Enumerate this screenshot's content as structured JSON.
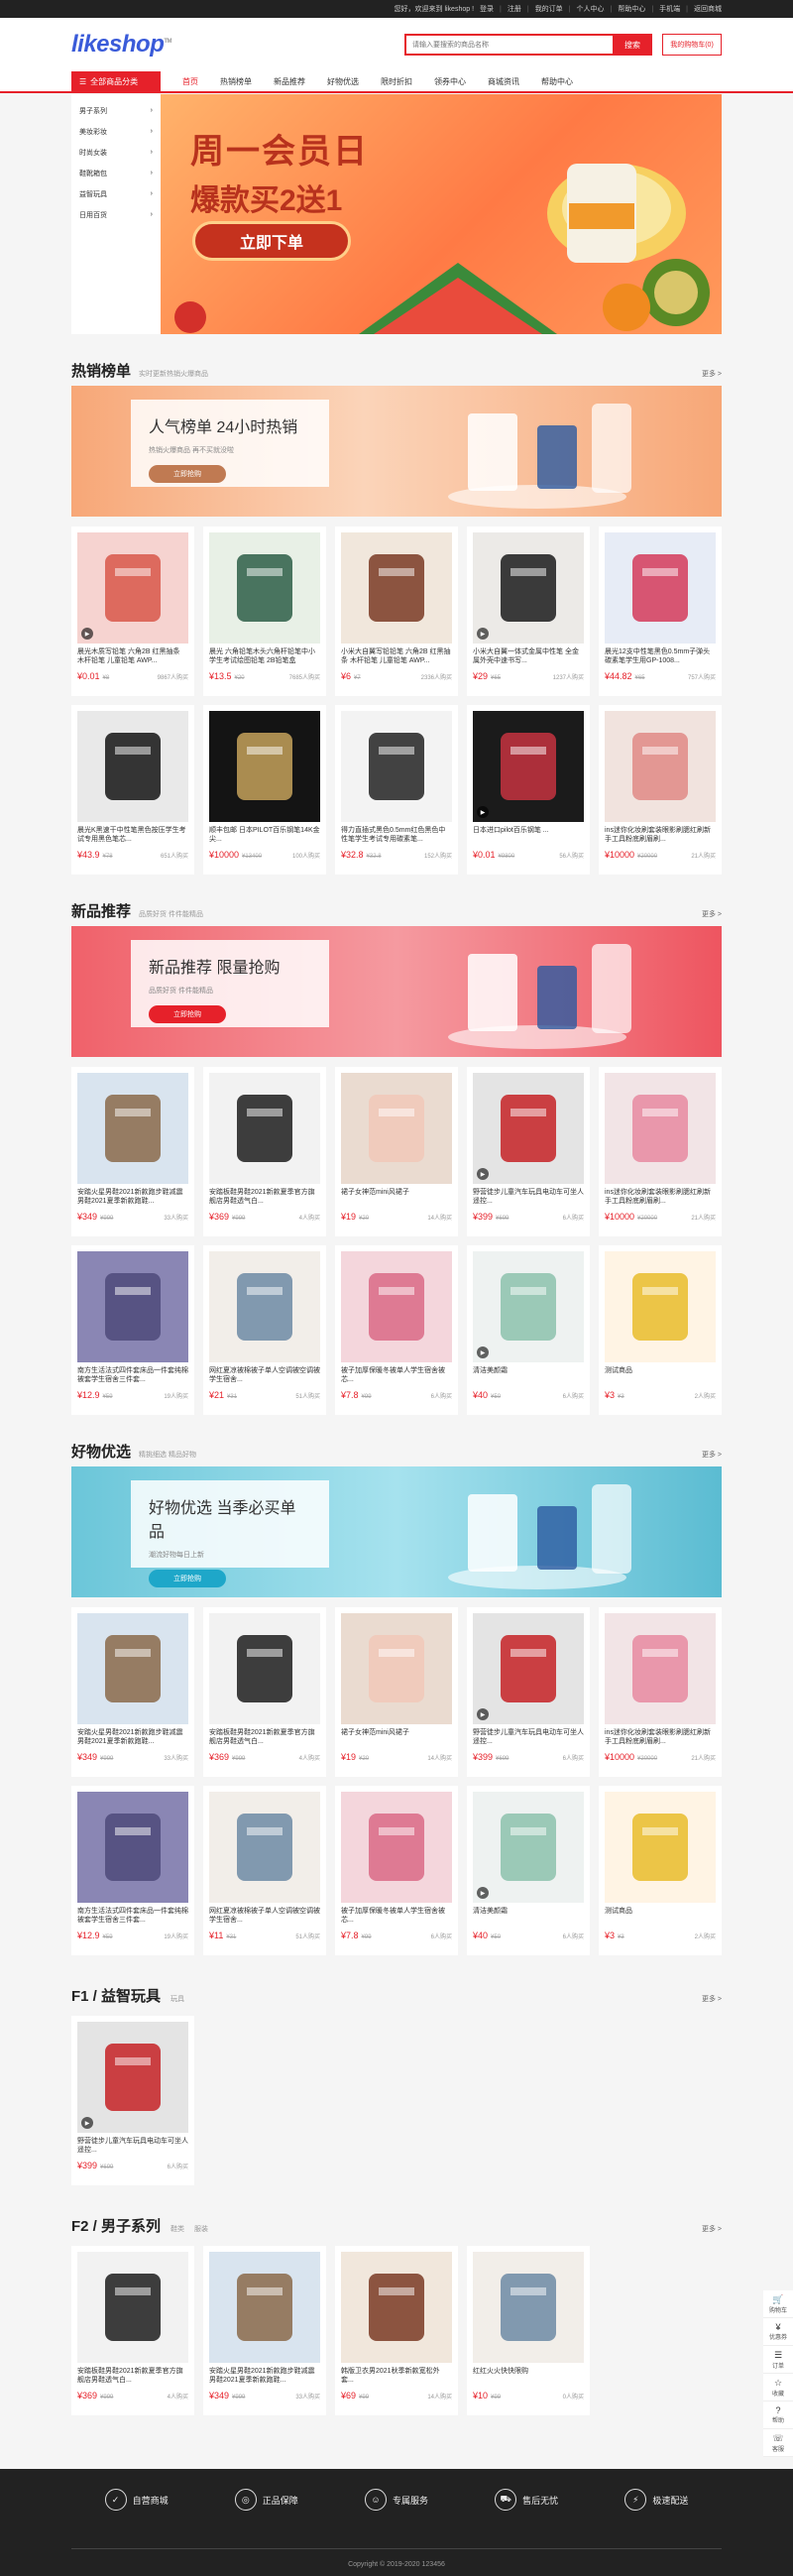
{
  "topbar": {
    "welcome": "您好，欢迎来到 likeshop !",
    "login": "登录",
    "register": "注册",
    "orders": "我的订单",
    "personal": "个人中心",
    "help": "帮助中心",
    "mobile": "手机端",
    "store": "返回商城"
  },
  "header": {
    "logo": "likeshop",
    "logo_tm": "TM",
    "search_placeholder": "请输入要搜索的商品名称",
    "search_btn": "搜索",
    "cart": "我的购物车(0)"
  },
  "nav": {
    "category": "全部商品分类",
    "items": [
      "首页",
      "热销榜单",
      "新品推荐",
      "好物优选",
      "限时折扣",
      "领券中心",
      "商城资讯",
      "帮助中心"
    ]
  },
  "catmenu": [
    "男子系列",
    "美妆彩妆",
    "时尚女装",
    "鞋靴箱包",
    "益智玩具",
    "日用百货"
  ],
  "hero": {
    "title": "周一会员日",
    "subtitle": "爆款买2送1",
    "button": "立即下单"
  },
  "hot": {
    "title": "热销榜单",
    "sub": "实时更新热销火爆商品",
    "more": "更多 >",
    "banner_title": "人气榜单 24小时热销",
    "banner_sub": "热销火爆商品 再不买就没啦",
    "banner_btn": "立即抢购",
    "items": [
      {
        "name": "晨光木质写铅笔 六角2B 红黑抽条 木杆铅笔 儿童铅笔 AWP...",
        "price": "¥0.01",
        "orig": "¥8",
        "sold": "9867人购买"
      },
      {
        "name": "晨光 六角铅笔木头六角杆铅笔中小学生考试绘图铅笔 2B铅笔盒",
        "price": "¥13.5",
        "orig": "¥20",
        "sold": "7685人购买"
      },
      {
        "name": "小米大自翼写铅铅笔 六角2B 红黑抽条 木杆铅笔 儿童铅笔 AWP...",
        "price": "¥6",
        "orig": "¥7",
        "sold": "2336人购买"
      },
      {
        "name": "小米大自翼一体式金属中性笔 全金属外壳中速书写...",
        "price": "¥29",
        "orig": "¥65",
        "sold": "1237人购买"
      },
      {
        "name": "晨光12支中性笔黑色0.5mm子弹头碳素笔学生用GP-1008...",
        "price": "¥44.82",
        "orig": "¥65",
        "sold": "757人购买"
      },
      {
        "name": "晨光K黑速干中性笔黑色按压学生考试专用黑色笔芯...",
        "price": "¥43.9",
        "orig": "¥78",
        "sold": "651人购买"
      },
      {
        "name": "顺丰包邮 日本PILOT百乐钢笔14K金尖...",
        "price": "¥10000",
        "orig": "¥13400",
        "sold": "100人购买"
      },
      {
        "name": "得力直插式黑色0.5mm红色黑色中性笔学生考试专用碳素笔...",
        "price": "¥32.8",
        "orig": "¥32.8",
        "sold": "152人购买"
      },
      {
        "name": "日本进口pilot百乐钢笔 ...",
        "price": "¥0.01",
        "orig": "¥9800",
        "sold": "56人购买"
      },
      {
        "name": "ins迷你化妆刷套装眼影刷腮红刷新手工具粉底刷眉刷...",
        "price": "¥10000",
        "orig": "¥20000",
        "sold": "21人购买"
      }
    ]
  },
  "new": {
    "title": "新品推荐",
    "sub": "品质好货 件件能精品",
    "more": "更多 >",
    "banner_title": "新品推荐 限量抢购",
    "banner_sub": "品质好货 件件能精品",
    "banner_btn": "立即抢购",
    "items": [
      {
        "name": "安踏火星男鞋2021新款跑步鞋减震男鞋2021夏季新款跑鞋...",
        "price": "¥349",
        "orig": "¥999",
        "sold": "33人购买"
      },
      {
        "name": "安踏板鞋男鞋2021新款夏季官方旗舰店男鞋透气白...",
        "price": "¥369",
        "orig": "¥999",
        "sold": "4人购买"
      },
      {
        "name": "裙子女神范mini风裙子",
        "price": "¥19",
        "orig": "¥20",
        "sold": "14人购买"
      },
      {
        "name": "野营徒步儿童汽车玩具电动车可坐人遥控...",
        "price": "¥399",
        "orig": "¥699",
        "sold": "6人购买"
      },
      {
        "name": "ins迷你化妆刷套装眼影刷腮红刷新手工具粉底刷眉刷...",
        "price": "¥10000",
        "orig": "¥20000",
        "sold": "21人购买"
      },
      {
        "name": "南方生活法式四件套床品一件套纯棉被套学生宿舍三件套...",
        "price": "¥12.9",
        "orig": "¥59",
        "sold": "19人购买"
      },
      {
        "name": "网红夏凉被棉被子单人空调被空调被学生宿舍...",
        "price": "¥21",
        "orig": "¥31",
        "sold": "51人购买"
      },
      {
        "name": "被子加厚保暖冬被单人学生宿舍被芯...",
        "price": "¥7.8",
        "orig": "¥99",
        "sold": "6人购买"
      },
      {
        "name": "清洁美颜霜",
        "price": "¥40",
        "orig": "¥50",
        "sold": "6人购买"
      },
      {
        "name": "测试商品",
        "price": "¥3",
        "orig": "¥3",
        "sold": "2人购买"
      }
    ]
  },
  "good": {
    "title": "好物优选",
    "sub": "精挑细选 精品好物",
    "more": "更多 >",
    "banner_title": "好物优选 当季必买单品",
    "banner_sub": "潮流好物每日上新",
    "banner_btn": "立即抢购",
    "items": [
      {
        "name": "安踏火星男鞋2021新款跑步鞋减震男鞋2021夏季新款跑鞋...",
        "price": "¥349",
        "orig": "¥999",
        "sold": "33人购买"
      },
      {
        "name": "安踏板鞋男鞋2021新款夏季官方旗舰店男鞋透气白...",
        "price": "¥369",
        "orig": "¥999",
        "sold": "4人购买"
      },
      {
        "name": "裙子女神范mini风裙子",
        "price": "¥19",
        "orig": "¥20",
        "sold": "14人购买"
      },
      {
        "name": "野营徒步儿童汽车玩具电动车可坐人遥控...",
        "price": "¥399",
        "orig": "¥699",
        "sold": "6人购买"
      },
      {
        "name": "ins迷你化妆刷套装眼影刷腮红刷新手工具粉底刷眉刷...",
        "price": "¥10000",
        "orig": "¥20000",
        "sold": "21人购买"
      },
      {
        "name": "南方生活法式四件套床品一件套纯棉被套学生宿舍三件套...",
        "price": "¥12.9",
        "orig": "¥59",
        "sold": "19人购买"
      },
      {
        "name": "网红夏凉被棉被子单人空调被空调被学生宿舍...",
        "price": "¥11",
        "orig": "¥31",
        "sold": "51人购买"
      },
      {
        "name": "被子加厚保暖冬被单人学生宿舍被芯...",
        "price": "¥7.8",
        "orig": "¥99",
        "sold": "6人购买"
      },
      {
        "name": "清洁美颜霜",
        "price": "¥40",
        "orig": "¥50",
        "sold": "6人购买"
      },
      {
        "name": "测试商品",
        "price": "¥3",
        "orig": "¥3",
        "sold": "2人购买"
      }
    ]
  },
  "f1": {
    "title": "F1 / 益智玩具",
    "tab": "玩具",
    "more": "更多 >",
    "items": [
      {
        "name": "野营徒步儿童汽车玩具电动车可坐人遥控...",
        "price": "¥399",
        "orig": "¥699",
        "sold": "6人购买"
      }
    ]
  },
  "f2": {
    "title": "F2 / 男子系列",
    "tabs": [
      "鞋类",
      "服装"
    ],
    "more": "更多 >",
    "items": [
      {
        "name": "安踏板鞋男鞋2021新款夏季官方旗舰店男鞋透气白...",
        "price": "¥369",
        "orig": "¥999",
        "sold": "4人购买"
      },
      {
        "name": "安踏火星男鞋2021新款跑步鞋减震男鞋2021夏季新款跑鞋...",
        "price": "¥349",
        "orig": "¥999",
        "sold": "33人购买"
      },
      {
        "name": "韩版卫衣男2021秋季新款宽松外套...",
        "price": "¥69",
        "orig": "¥99",
        "sold": "14人购买"
      },
      {
        "name": "红红火火快快限购",
        "price": "¥10",
        "orig": "¥99",
        "sold": "0人购买"
      }
    ]
  },
  "footer": {
    "services": [
      "自营商城",
      "正品保障",
      "专属服务",
      "售后无忧",
      "极速配送"
    ],
    "copyright": "Copyright © 2019-2020 123456"
  },
  "sidebar": [
    "购物车",
    "优惠券",
    "订单",
    "收藏",
    "帮助",
    "客服"
  ]
}
